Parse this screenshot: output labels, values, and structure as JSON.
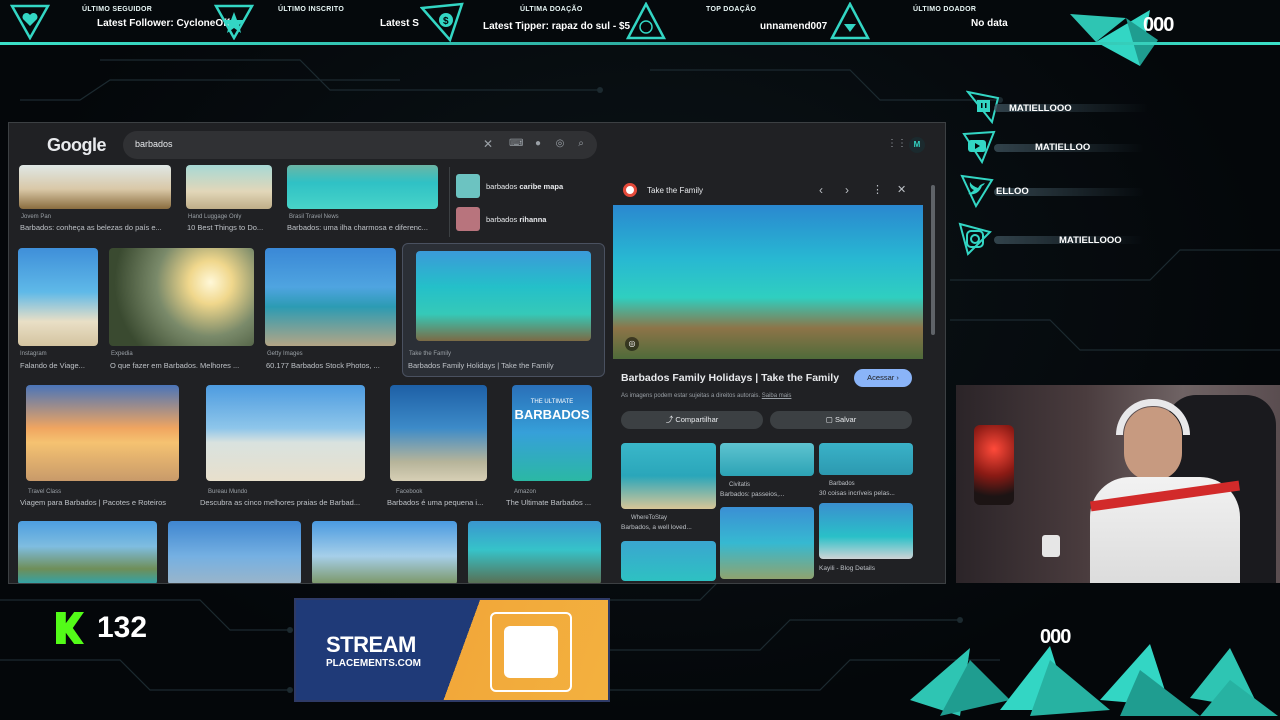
{
  "colors": {
    "accent": "#33d6c4",
    "google_blue": "#8ab4f8",
    "kick_green": "#53fc18"
  },
  "topbar": {
    "last_follower": {
      "label": "ÚLTIMO SEGUIDOR",
      "value": "Latest Follower: CycloneOff"
    },
    "last_sub": {
      "label": "ÚLTIMO INSCRITO",
      "value": "Latest S"
    },
    "last_donation": {
      "label": "ÚLTIMA DOAÇÃO",
      "value": "Latest Tipper: rapaz do sul - $5"
    },
    "top_donation": {
      "label": "TOP DOAÇÃO",
      "value": "unnamend007"
    },
    "last_donor": {
      "label": "ÚLTIMO DOADOR",
      "value": "No data"
    },
    "brand_fragment": "000"
  },
  "browser": {
    "logo": "Google",
    "search_value": "barbados",
    "grid": {
      "row1": [
        {
          "source": "Jovem Pan",
          "caption": "Barbados: conheça as belezas do país e..."
        },
        {
          "source": "Hand Luggage Only",
          "caption": "10 Best Things to Do..."
        },
        {
          "source": "Brasil Travel News",
          "caption": "Barbados: uma ilha charmosa e diferenc..."
        }
      ],
      "suggestions": [
        {
          "prefix": "barbados ",
          "bold": "caribe mapa"
        },
        {
          "prefix": "barbados ",
          "bold": "rihanna"
        }
      ],
      "row2": [
        {
          "source": "Instagram",
          "caption": "Falando de Viage..."
        },
        {
          "source": "Expedia",
          "caption": "O que fazer em Barbados. Melhores ..."
        },
        {
          "source": "Getty Images",
          "caption": "60.177 Barbados Stock Photos, ..."
        },
        {
          "source": "Take the Family",
          "caption": "Barbados Family Holidays | Take the Family"
        }
      ],
      "row3": [
        {
          "source": "Travel Class",
          "caption": "Viagem para Barbados | Pacotes e Roteiros"
        },
        {
          "source": "Bureau Mundo",
          "caption": "Descubra as cinco melhores praias de Barbad..."
        },
        {
          "source": "Facebook",
          "caption": "Barbados é uma pequena i..."
        },
        {
          "source": "Amazon",
          "caption": "The Ultimate Barbados ..."
        }
      ],
      "book_title_small": "THE ULTIMATE",
      "book_title": "BARBADOS"
    },
    "panel": {
      "site": "Take the Family",
      "title": "Barbados Family Holidays | Take the Family",
      "visit": "Acessar",
      "copyright": "As imagens podem estar sujeitas a direitos autorais.",
      "learn_more": "Saiba mais",
      "share": "Compartilhar",
      "save": "Salvar",
      "related": [
        {
          "source": "",
          "caption": ""
        },
        {
          "source": "Civitatis",
          "caption": "Barbados: passeios,..."
        },
        {
          "source": "Barbados",
          "caption": "30 coisas incríveis pelas..."
        },
        {
          "source": "WhereToStay",
          "caption": "Barbados, a well loved..."
        },
        {
          "source": "Kayili - Blog Details",
          "caption": ""
        }
      ]
    }
  },
  "socials": [
    {
      "platform": "twitch-icon",
      "handle": "MATIELLOOO"
    },
    {
      "platform": "youtube-icon",
      "handle": "MATIELLOO"
    },
    {
      "platform": "twitter-icon",
      "handle": "ELLOO"
    },
    {
      "platform": "instagram-icon",
      "handle": "MATIELLOOO"
    }
  ],
  "bottom": {
    "kick_count": "132",
    "brand_fragment": "000",
    "ad_line1": "STREAM",
    "ad_line2": "PLACEMENTS.COM"
  }
}
